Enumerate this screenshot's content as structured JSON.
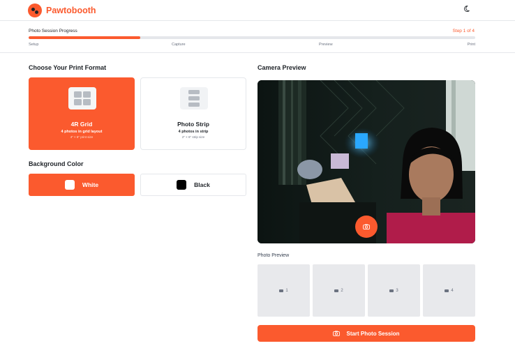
{
  "app": {
    "name": "Pawtobooth"
  },
  "progress": {
    "title": "Photo Session Progress",
    "step_text": "Step 1 of 4",
    "fraction": 0.25,
    "steps": [
      "Setup",
      "Capture",
      "Preview",
      "Print"
    ]
  },
  "format": {
    "title": "Choose Your Print Format",
    "options": [
      {
        "name": "4R Grid",
        "description": "4 photos in grid layout",
        "size": "4\" × 6\" print size",
        "selected": true
      },
      {
        "name": "Photo Strip",
        "description": "4 photos in strip",
        "size": "2\" × 6\" strip size",
        "selected": false
      }
    ]
  },
  "background": {
    "title": "Background Color",
    "options": [
      {
        "label": "White",
        "color": "#ffffff",
        "selected": true
      },
      {
        "label": "Black",
        "color": "#000000",
        "selected": false
      }
    ]
  },
  "camera": {
    "title": "Camera Preview"
  },
  "photo_preview": {
    "title": "Photo Preview",
    "slots": [
      "1",
      "2",
      "3",
      "4"
    ]
  },
  "start_button": {
    "label": "Start Photo Session"
  },
  "colors": {
    "accent": "#fb5a2e",
    "border": "#e5e7eb",
    "muted": "#6b7280"
  },
  "icons": {
    "logo": "paw-logo-icon",
    "theme": "moon-icon",
    "shutter": "camera-icon"
  }
}
